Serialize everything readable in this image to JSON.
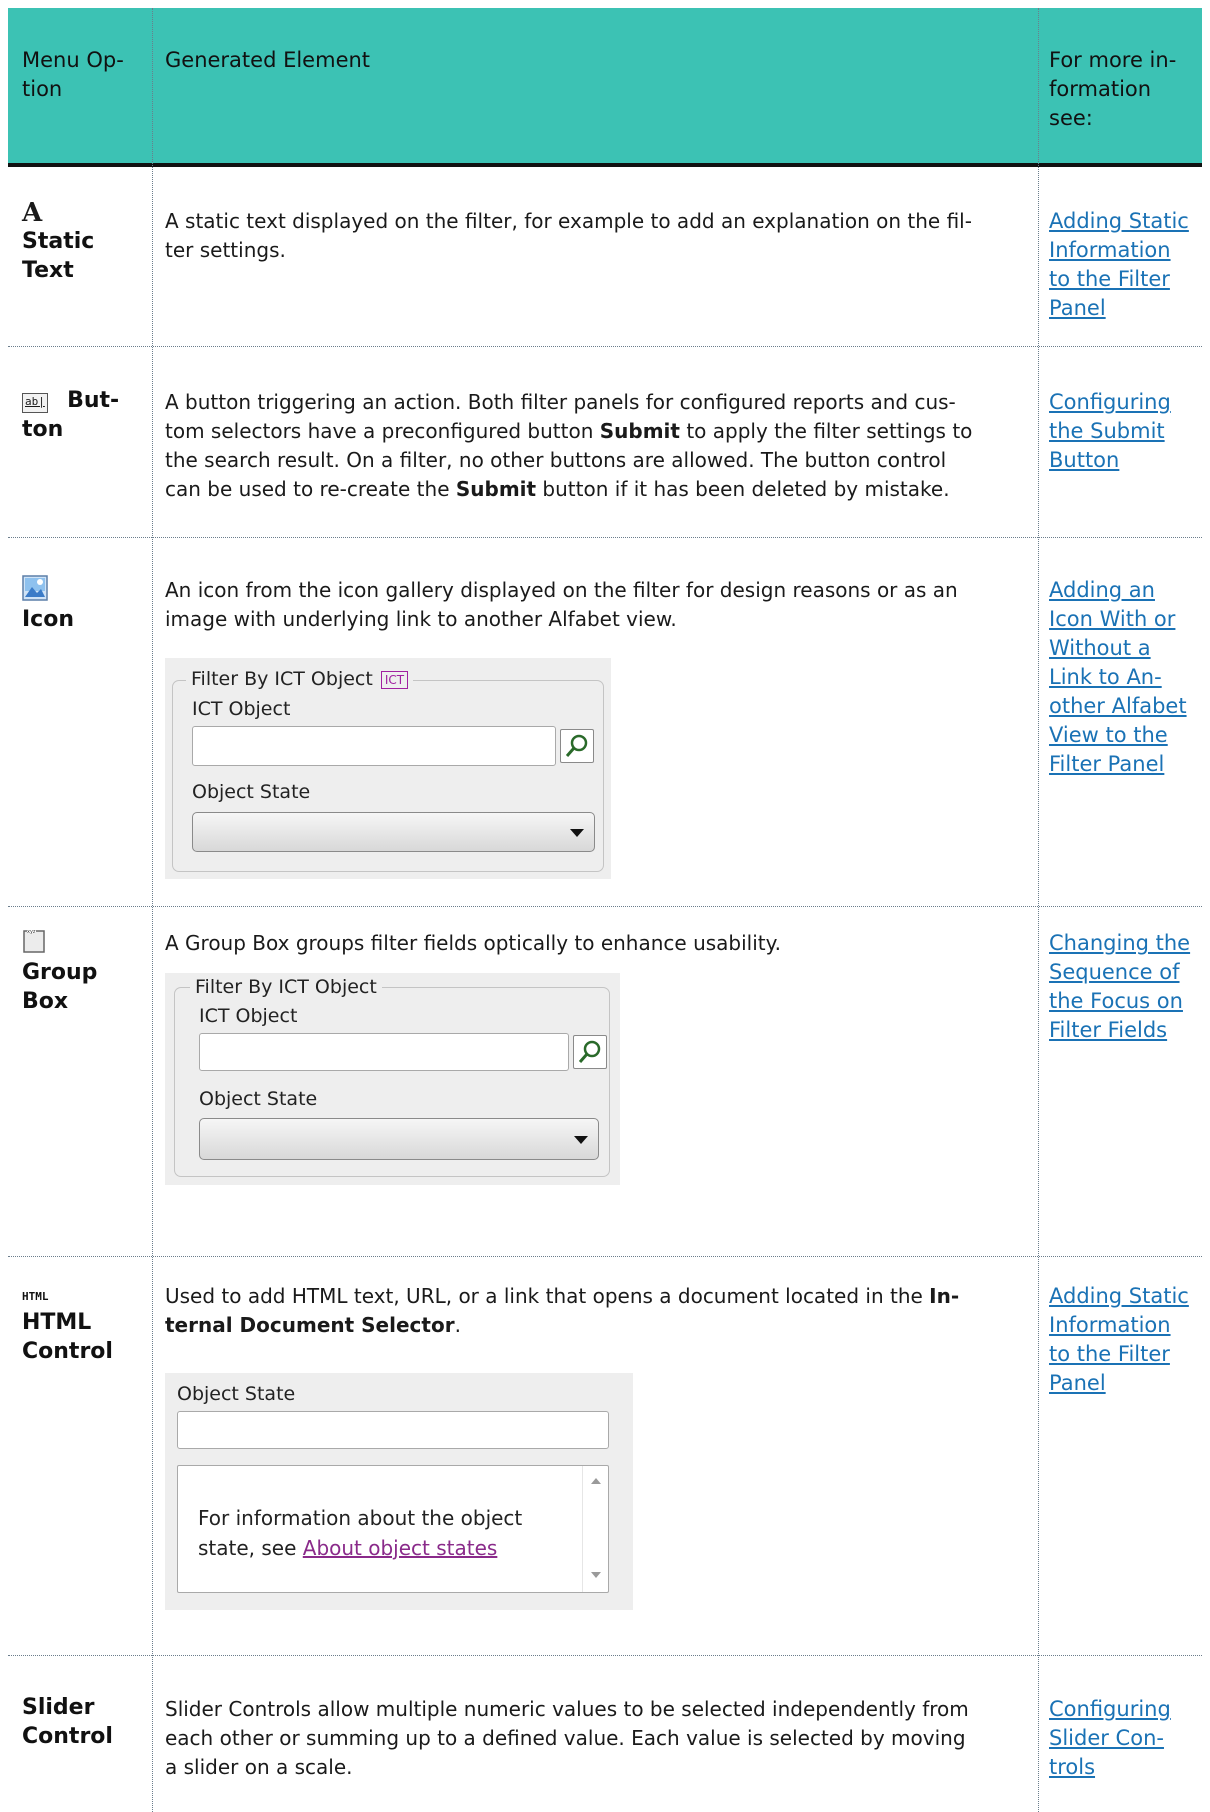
{
  "header": {
    "col1": "Menu Op-tion",
    "col1_l1": "Menu Op-",
    "col1_l2": "tion",
    "col2": "Generated Element",
    "col3_l1": "For more in-",
    "col3_l2": "formation",
    "col3_l3": "see:"
  },
  "rows": {
    "static_text": {
      "icon": "A",
      "label_l1": "Static",
      "label_l2": "Text",
      "desc": "A static text displayed on the filter, for example to add an explanation on the fil-ter settings.",
      "desc_l1": "A static text displayed on the filter, for example to add an explanation on the fil-",
      "desc_l2": "ter settings.",
      "link_lines": [
        "Adding Static",
        "Information",
        "to the Filter",
        "Panel"
      ]
    },
    "button": {
      "icon": "ab|",
      "label_l1": "But-",
      "label_l2": "ton",
      "desc_l1": "A button triggering an action. Both filter panels for configured reports and cus-",
      "desc_l2a": "tom selectors have a preconfigured button ",
      "desc_l2b": "Submit",
      "desc_l2c": " to apply the filter settings to",
      "desc_l3": "the search result. On a filter, no other buttons are allowed. The button control",
      "desc_l4a": "can be used to re-create the ",
      "desc_l4b": "Submit",
      "desc_l4c": " button if it has been deleted by mistake.",
      "link_lines": [
        "Configuring",
        "the Submit",
        "Button"
      ]
    },
    "icon": {
      "label": "Icon",
      "desc_l1": "An icon from the icon gallery displayed on the filter for design reasons or as an",
      "desc_l2": "image with underlying link to another Alfabet view.",
      "preview": {
        "legend": "Filter By ICT Object",
        "badge": "ICT",
        "field_label": "ICT Object",
        "state_label": "Object State"
      },
      "link_lines": [
        "Adding an",
        "Icon With or",
        "Without a",
        "Link to An-",
        "other Alfabet",
        "View to the",
        "Filter Panel"
      ]
    },
    "group_box": {
      "label_l1": "Group",
      "label_l2": "Box",
      "desc": "A Group Box groups filter fields optically to enhance usability.",
      "preview": {
        "legend": "Filter By ICT Object",
        "field_label": "ICT Object",
        "state_label": "Object State"
      },
      "link_lines": [
        "Changing the",
        "Sequence of",
        "the Focus on",
        "Filter Fields"
      ]
    },
    "html_control": {
      "icon": "HTML",
      "label_l1": "HTML",
      "label_l2": "Control",
      "desc_l1a": "Used to add HTML text, URL, or a link that opens a document located in the ",
      "desc_l1b": "In-",
      "desc_l2a": "ternal Document Selector",
      "desc_l2b": ".",
      "preview": {
        "state_label": "Object State",
        "info_l1": "For information about the object",
        "info_l2": "state, see ",
        "info_link": "About object states"
      },
      "link_lines": [
        "Adding Static",
        "Information",
        "to the Filter",
        "Panel"
      ]
    },
    "slider": {
      "label_l1": "Slider",
      "label_l2": "Control",
      "desc_l1": "Slider Controls allow multiple numeric values to be selected independently from",
      "desc_l2": "each other or summing up to a defined value. Each value is selected by moving",
      "desc_l3": "a slider on a scale.",
      "link_lines": [
        "Configuring",
        "Slider Con-",
        "trols"
      ]
    }
  }
}
